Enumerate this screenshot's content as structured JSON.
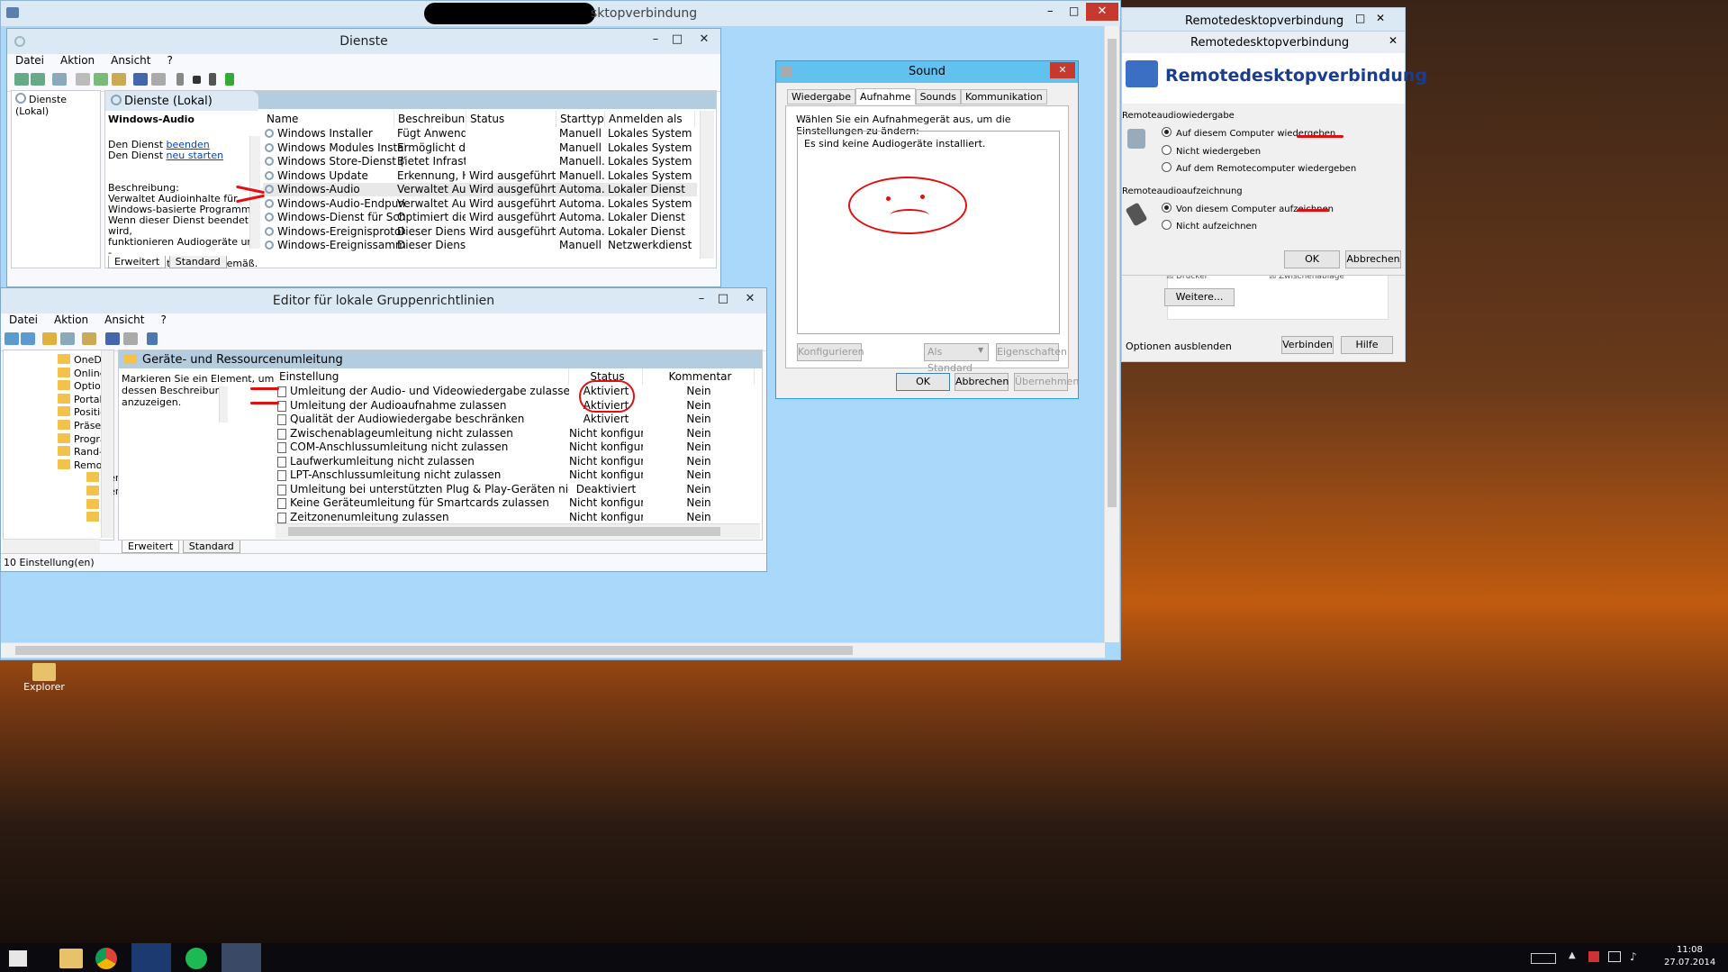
{
  "rdp_window": {
    "title_visible": "sktopverbindung"
  },
  "dienste": {
    "title": "Dienste",
    "menu": [
      "Datei",
      "Aktion",
      "Ansicht",
      "?"
    ],
    "tree_item": "Dienste (Lokal)",
    "panel_title": "Dienste (Lokal)",
    "service_name": "Windows-Audio",
    "desc_line1_prefix": "Den Dienst",
    "desc_link1": "beenden",
    "desc_line2_prefix": "Den Dienst",
    "desc_link2": "neu starten",
    "description_label": "Beschreibung:",
    "description_lines": [
      "Verwaltet Audioinhalte für",
      "Windows-basierte Programme.",
      "Wenn dieser Dienst beendet wird,",
      "funktionieren Audiogeräte und -",
      "effekte nicht ordnungsgemäß."
    ],
    "columns": [
      "Name",
      "Beschreibung",
      "Status",
      "Starttyp",
      "Anmelden als"
    ],
    "rows": [
      [
        "Windows Installer",
        "Fügt Anwend...",
        "",
        "Manuell",
        "Lokales System"
      ],
      [
        "Windows Modules Installer",
        "Ermöglicht da...",
        "",
        "Manuell",
        "Lokales System"
      ],
      [
        "Windows Store-Dienst (WSS...",
        "Bietet Infrastr...",
        "",
        "Manuell...",
        "Lokales System"
      ],
      [
        "Windows Update",
        "Erkennung, H...",
        "Wird ausgeführt",
        "Manuell...",
        "Lokales System"
      ],
      [
        "Windows-Audio",
        "Verwaltet Aud...",
        "Wird ausgeführt",
        "Automa...",
        "Lokaler Dienst"
      ],
      [
        "Windows-Audio-Endpunkt...",
        "Verwaltet Aud...",
        "Wird ausgeführt",
        "Automa...",
        "Lokales System"
      ],
      [
        "Windows-Dienst für Schrift...",
        "Optimiert die ...",
        "Wird ausgeführt",
        "Automa...",
        "Lokaler Dienst"
      ],
      [
        "Windows-Ereignisprotokoll",
        "Dieser Dienst ...",
        "Wird ausgeführt",
        "Automa...",
        "Lokaler Dienst"
      ],
      [
        "Windows-Ereignissammlung",
        "Dieser Dienst ...",
        "",
        "Manuell",
        "Netzwerkdienst"
      ]
    ],
    "tabs": [
      "Erweitert",
      "Standard"
    ]
  },
  "gpedit": {
    "title": "Editor für lokale Gruppenrichtlinien",
    "menu": [
      "Datei",
      "Aktion",
      "Ansicht",
      "?"
    ],
    "tree": [
      "OneDr",
      "Online",
      "Option",
      "Portab",
      "Positio",
      "Präsen",
      "Progra",
      "Rand-U",
      "Remot",
      "Rer",
      "Rer",
      "",
      ""
    ],
    "panel_title": "Geräte- und Ressourcenumleitung",
    "hint": "Markieren Sie ein Element, um dessen Beschreibung anzuzeigen.",
    "columns": [
      "Einstellung",
      "Status",
      "Kommentar"
    ],
    "rows": [
      [
        "Umleitung der Audio- und Videowiedergabe zulassen",
        "Aktiviert",
        "Nein"
      ],
      [
        "Umleitung der Audioaufnahme zulassen",
        "Aktiviert",
        "Nein"
      ],
      [
        "Qualität der Audiowiedergabe beschränken",
        "Aktiviert",
        "Nein"
      ],
      [
        "Zwischenablageumleitung nicht zulassen",
        "Nicht konfigur...",
        "Nein"
      ],
      [
        "COM-Anschlussumleitung nicht zulassen",
        "Nicht konfigur...",
        "Nein"
      ],
      [
        "Laufwerkumleitung nicht zulassen",
        "Nicht konfigur...",
        "Nein"
      ],
      [
        "LPT-Anschlussumleitung nicht zulassen",
        "Nicht konfigur...",
        "Nein"
      ],
      [
        "Umleitung bei unterstützten Plug & Play-Geräten nicht zulassen",
        "Deaktiviert",
        "Nein"
      ],
      [
        "Keine Geräteumleitung für Smartcards zulassen",
        "Nicht konfigur...",
        "Nein"
      ],
      [
        "Zeitzonenumleitung zulassen",
        "Nicht konfigur...",
        "Nein"
      ]
    ],
    "tabs": [
      "Erweitert",
      "Standard"
    ],
    "status_bar": "10 Einstellung(en)"
  },
  "sound": {
    "title": "Sound",
    "tabs": [
      "Wiedergabe",
      "Aufnahme",
      "Sounds",
      "Kommunikation"
    ],
    "instruction": "Wählen Sie ein Aufnahmegerät aus, um die Einstellungen zu ändern:",
    "empty_message": "Es sind keine Audiogeräte installiert.",
    "buttons": {
      "configure": "Konfigurieren",
      "default": "Als Standard",
      "properties": "Eigenschaften",
      "ok": "OK",
      "cancel": "Abbrechen",
      "apply": "Übernehmen"
    }
  },
  "rdc_outer": {
    "title": "Remotedesktopverbindung"
  },
  "rdc_dialog": {
    "title": "Remotedesktopverbindung",
    "heading": "Remotedesktopverbindung",
    "playback_label": "Remoteaudiowiedergabe",
    "playback_options": [
      "Auf diesem Computer wiedergeben",
      "Nicht wiedergeben",
      "Auf dem Remotecomputer wiedergeben"
    ],
    "record_label": "Remoteaudioaufzeichnung",
    "record_options": [
      "Von diesem Computer aufzeichnen",
      "Nicht aufzeichnen"
    ],
    "ok": "OK",
    "cancel": "Abbrechen",
    "partial_left": "Drucker",
    "partial_right": "Zwischenablage",
    "more": "Weitere...",
    "hide_options": "Optionen ausblenden",
    "connect": "Verbinden",
    "help": "Hilfe"
  },
  "desktop": {
    "icon_label": "Explorer"
  },
  "taskbar": {
    "time": "11:08",
    "date": "27.07.2014"
  }
}
